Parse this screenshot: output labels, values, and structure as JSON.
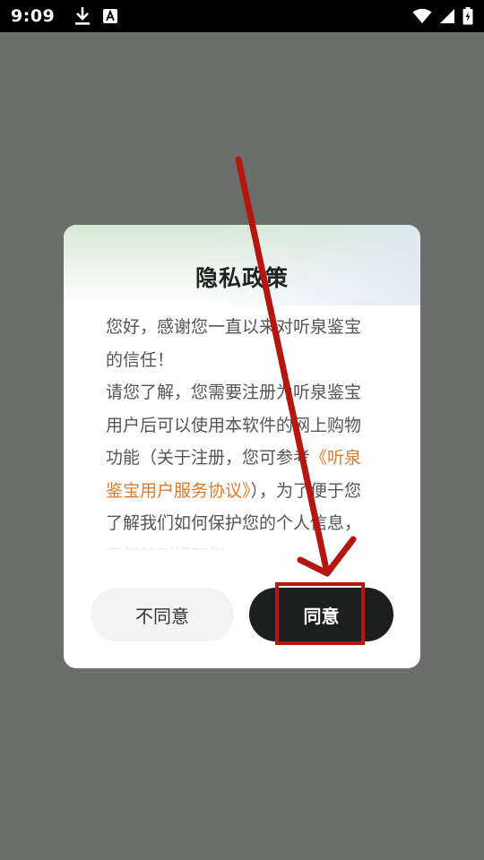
{
  "status_bar": {
    "time": "9:09",
    "icons": [
      "download-icon",
      "a-font-icon",
      "wifi-icon",
      "cellular-signal-icon",
      "battery-charging-icon"
    ]
  },
  "dialog": {
    "title": "隐私政策",
    "body_intro": "您好，感谢您一直以来对听泉鉴宝的信任！",
    "body_line2_prefix": " 请您了解，您需要注册为听泉鉴宝用户后可以使用本软件的网上购物功能（关于注册，您可参考",
    "body_link": "《听泉鉴宝用户服务协议》",
    "body_line2_suffix": "），为了便于您了解我们如何保护您的个人信息，我们特别提醒您",
    "disagree_label": "不同意",
    "agree_label": "同意"
  },
  "colors": {
    "link": "#e07a2c",
    "agree_button": "#1c1f1d",
    "annotation_red": "#b5170f"
  }
}
